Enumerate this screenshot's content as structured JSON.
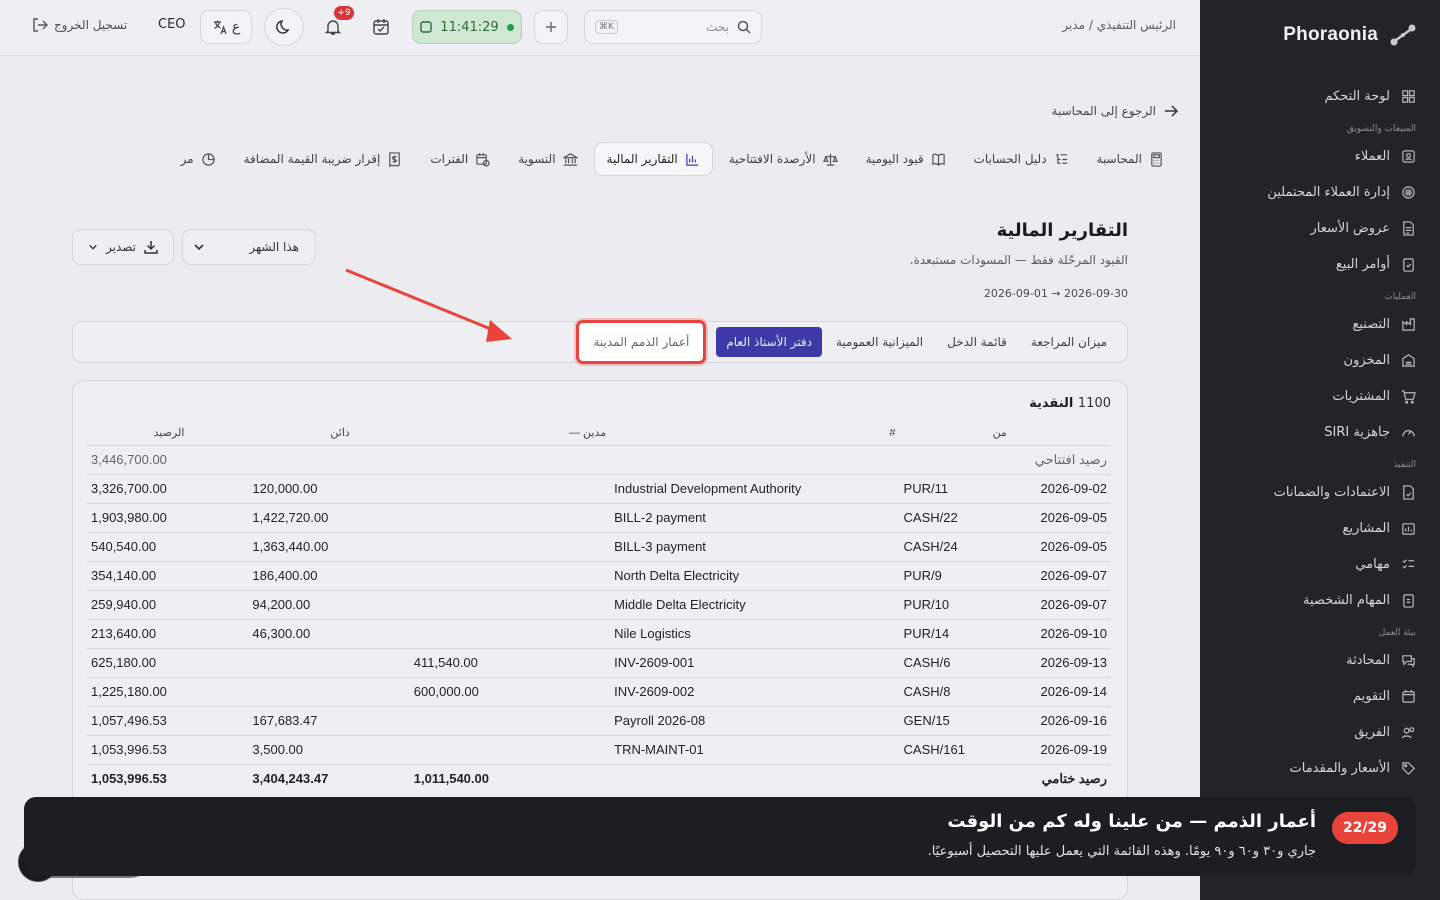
{
  "brand": {
    "name": "Phoraonia"
  },
  "sidebar": {
    "items": [
      {
        "label": "لوحة التحكم",
        "icon": "grid-icon"
      },
      {
        "section": "المبيعات والتسويق"
      },
      {
        "label": "العملاء",
        "icon": "contacts-icon"
      },
      {
        "label": "إدارة العملاء المحتملين",
        "icon": "target-icon"
      },
      {
        "label": "عروض الأسعار",
        "icon": "document-icon"
      },
      {
        "label": "أوامر البيع",
        "icon": "clipboard-check-icon"
      },
      {
        "section": "العمليات"
      },
      {
        "label": "التصنيع",
        "icon": "factory-icon"
      },
      {
        "label": "المخزون",
        "icon": "warehouse-icon"
      },
      {
        "label": "المشتريات",
        "icon": "cart-icon"
      },
      {
        "label": "جاهزية SIRI",
        "icon": "gauge-icon"
      },
      {
        "section": "التنفيذ"
      },
      {
        "label": "الاعتمادات والضمانات",
        "icon": "file-check-icon"
      },
      {
        "label": "المشاريع",
        "icon": "chart-box-icon"
      },
      {
        "label": "مهامي",
        "icon": "checklist-icon"
      },
      {
        "label": "المهام الشخصية",
        "icon": "clipboard-icon"
      },
      {
        "section": "بيئة العمل"
      },
      {
        "label": "المحادثة",
        "icon": "chat-icon"
      },
      {
        "label": "التقويم",
        "icon": "calendar-icon"
      },
      {
        "label": "الفريق",
        "icon": "users-icon"
      },
      {
        "label": "الأسعار والمقدمات",
        "icon": "tag-icon"
      }
    ]
  },
  "topbar": {
    "title": "الرئيس التنفيذي / مدير",
    "search_placeholder": "بحث",
    "search_kbd": "K⌘",
    "clock": "11:41:29",
    "notifications_badge": "+9",
    "lang": "ع",
    "role": "CEO",
    "logout": "تسجيل الخروج"
  },
  "nav": {
    "back": "الرجوع إلى المحاسبة",
    "tabs": [
      {
        "label": "المحاسبة",
        "icon": "calculator-icon"
      },
      {
        "label": "دليل الحسابات",
        "icon": "list-tree-icon"
      },
      {
        "label": "قيود اليومية",
        "icon": "book-icon"
      },
      {
        "label": "الأرصدة الافتتاحية",
        "icon": "scale-icon"
      },
      {
        "label": "التقارير المالية",
        "icon": "bar-chart-icon",
        "active": true
      },
      {
        "label": "التسوية",
        "icon": "bank-icon"
      },
      {
        "label": "الفترات",
        "icon": "calendar-clock-icon"
      },
      {
        "label": "إقرار ضريبة القيمة المضافة",
        "icon": "receipt-icon"
      },
      {
        "label": "مر",
        "icon": "pie-chart-icon"
      }
    ]
  },
  "page": {
    "title": "التقارير المالية",
    "subtitle": "القيود المرحّلة فقط — المسودات مستبعدة.",
    "daterange": "2026-09-01 → 2026-09-30",
    "period": "هذا الشهر",
    "export": "تصدير"
  },
  "report_tabs": [
    {
      "label": "ميزان المراجعة"
    },
    {
      "label": "قائمة الدخل"
    },
    {
      "label": "الميزانية العمومية"
    },
    {
      "label": "دفتر الأستاذ العام",
      "active": true
    },
    {
      "label": "أعمار الذمم المدينة",
      "highlight": true
    }
  ],
  "ledger": {
    "account_code": "1100",
    "account_name": "النقدية",
    "headers": {
      "date": "",
      "from": "من",
      "desc": "#",
      "debit": "مدين",
      "credit": "دائن",
      "balance": "الرصيد"
    },
    "opening": {
      "label": "رصيد افتتاحي",
      "balance": "3,446,700.00"
    },
    "rows": [
      {
        "date": "2026-09-02",
        "from": "PUR/11",
        "desc": "Industrial Development Authority",
        "debit": "",
        "credit": "120,000.00",
        "balance": "3,326,700.00"
      },
      {
        "date": "2026-09-05",
        "from": "CASH/22",
        "desc": "BILL-2 payment",
        "debit": "",
        "credit": "1,422,720.00",
        "balance": "1,903,980.00"
      },
      {
        "date": "2026-09-05",
        "from": "CASH/24",
        "desc": "BILL-3 payment",
        "debit": "",
        "credit": "1,363,440.00",
        "balance": "540,540.00"
      },
      {
        "date": "2026-09-07",
        "from": "PUR/9",
        "desc": "North Delta Electricity",
        "debit": "",
        "credit": "186,400.00",
        "balance": "354,140.00"
      },
      {
        "date": "2026-09-07",
        "from": "PUR/10",
        "desc": "Middle Delta Electricity",
        "debit": "",
        "credit": "94,200.00",
        "balance": "259,940.00"
      },
      {
        "date": "2026-09-10",
        "from": "PUR/14",
        "desc": "Nile Logistics",
        "debit": "",
        "credit": "46,300.00",
        "balance": "213,640.00"
      },
      {
        "date": "2026-09-13",
        "from": "CASH/6",
        "desc": "INV-2609-001",
        "debit": "411,540.00",
        "credit": "",
        "balance": "625,180.00"
      },
      {
        "date": "2026-09-14",
        "from": "CASH/8",
        "desc": "INV-2609-002",
        "debit": "600,000.00",
        "credit": "",
        "balance": "1,225,180.00"
      },
      {
        "date": "2026-09-16",
        "from": "GEN/15",
        "desc": "Payroll 2026-08",
        "debit": "",
        "credit": "167,683.47",
        "balance": "1,057,496.53"
      },
      {
        "date": "2026-09-19",
        "from": "CASH/161",
        "desc": "TRN-MAINT-01",
        "debit": "",
        "credit": "3,500.00",
        "balance": "1,053,996.53"
      }
    ],
    "closing": {
      "label": "رصيد ختامي",
      "debit": "1,011,540.00",
      "credit": "3,404,243.47",
      "balance": "1,053,996.53"
    }
  },
  "tour": {
    "step": "22/29",
    "title": "أعمار الذمم — من علينا وله كم من الوقت",
    "body": "جاري و٣٠ و٦٠ و٩٠ يومًا. وهذه القائمة التي يعمل عليها التحصيل أسبوعيًا."
  },
  "colors": {
    "accent": "#3d3aa8",
    "highlight": "#e8443c",
    "sidebar": "#232328",
    "success": "#21a04a"
  }
}
